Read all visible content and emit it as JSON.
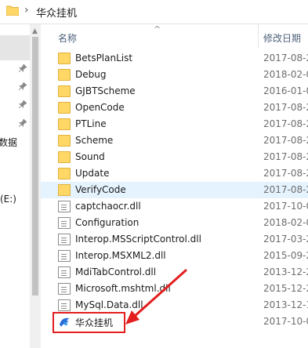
{
  "breadcrumb": {
    "current": "华众挂机",
    "separator": "›"
  },
  "nav": {
    "item_data": "数据",
    "item_drive": "(E:)"
  },
  "header": {
    "name": "名称",
    "date": "修改日期",
    "sort_glyph": "^"
  },
  "files": [
    {
      "name": "BetsPlanList",
      "date": "2017-08-2",
      "type": "folder"
    },
    {
      "name": "Debug",
      "date": "2018-02-0",
      "type": "folder"
    },
    {
      "name": "GJBTScheme",
      "date": "2016-01-0",
      "type": "folder"
    },
    {
      "name": "OpenCode",
      "date": "2017-08-2",
      "type": "folder"
    },
    {
      "name": "PTLine",
      "date": "2017-08-2",
      "type": "folder"
    },
    {
      "name": "Scheme",
      "date": "2017-08-2",
      "type": "folder"
    },
    {
      "name": "Sound",
      "date": "2017-08-2",
      "type": "folder"
    },
    {
      "name": "Update",
      "date": "2017-08-2",
      "type": "folder"
    },
    {
      "name": "VerifyCode",
      "date": "2017-08-2",
      "type": "folder"
    },
    {
      "name": "captchaocr.dll",
      "date": "2017-10-0",
      "type": "file"
    },
    {
      "name": "Configuration",
      "date": "2018-02-0",
      "type": "file"
    },
    {
      "name": "Interop.MSScriptControl.dll",
      "date": "2017-03-2",
      "type": "file"
    },
    {
      "name": "Interop.MSXML2.dll",
      "date": "2015-09-2",
      "type": "file"
    },
    {
      "name": "MdiTabControl.dll",
      "date": "2013-12-2",
      "type": "file"
    },
    {
      "name": "Microsoft.mshtml.dll",
      "date": "2015-12-2",
      "type": "file"
    },
    {
      "name": "MySql.Data.dll",
      "date": "2013-12-1",
      "type": "file"
    },
    {
      "name": "华众挂机",
      "date": "2017-10-0",
      "type": "app"
    }
  ],
  "colors": {
    "highlight": "#e31e1e",
    "selected_row": "#e5f3ff",
    "folder": "#ffd766"
  }
}
